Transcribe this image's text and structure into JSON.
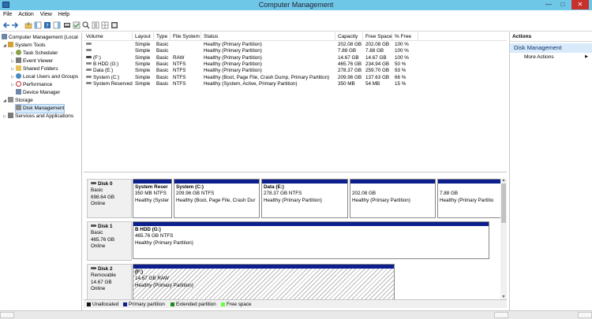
{
  "window": {
    "title": "Computer Management",
    "min": "—",
    "max": "□",
    "close": "✕"
  },
  "menu": [
    "File",
    "Action",
    "View",
    "Help"
  ],
  "tree": {
    "root": "Computer Management (Local",
    "system_tools": "System Tools",
    "task_scheduler": "Task Scheduler",
    "event_viewer": "Event Viewer",
    "shared_folders": "Shared Folders",
    "local_users": "Local Users and Groups",
    "performance": "Performance",
    "device_manager": "Device Manager",
    "storage": "Storage",
    "disk_management": "Disk Management",
    "services": "Services and Applications"
  },
  "volume_table": {
    "headers": [
      "Volume",
      "Layout",
      "Type",
      "File System",
      "Status",
      "Capacity",
      "Free Space",
      "% Free"
    ],
    "rows": [
      [
        "",
        "Simple",
        "Basic",
        "",
        "Healthy (Primary Partition)",
        "202.08 GB",
        "202.08 GB",
        "100 %"
      ],
      [
        "",
        "Simple",
        "Basic",
        "",
        "Healthy (Primary Partition)",
        "7.88 GB",
        "7.88 GB",
        "100 %"
      ],
      [
        "(F:)",
        "Simple",
        "Basic",
        "RAW",
        "Healthy (Primary Partition)",
        "14.67 GB",
        "14.67 GB",
        "100 %"
      ],
      [
        "B HDD (G:)",
        "Simple",
        "Basic",
        "NTFS",
        "Healthy (Primary Partition)",
        "465.76 GB",
        "234.94 GB",
        "50 %"
      ],
      [
        "Data (E:)",
        "Simple",
        "Basic",
        "NTFS",
        "Healthy (Primary Partition)",
        "278.37 GB",
        "259.70 GB",
        "93 %"
      ],
      [
        "System (C:)",
        "Simple",
        "Basic",
        "NTFS",
        "Healthy (Boot, Page File, Crash Dump, Primary Partition)",
        "209.96 GB",
        "137.63 GB",
        "66 %"
      ],
      [
        "System Reserved",
        "Simple",
        "Basic",
        "NTFS",
        "Healthy (System, Active, Primary Partition)",
        "350 MB",
        "54 MB",
        "15 %"
      ]
    ]
  },
  "disks": {
    "d0": {
      "name": "Disk 0",
      "type": "Basic",
      "size": "698.64 GB",
      "status": "Online",
      "parts": [
        {
          "name": "System Reser",
          "size": "350 MB NTFS",
          "status": "Healthy (Syster"
        },
        {
          "name": "System  (C:)",
          "size": "209.96 GB NTFS",
          "status": "Healthy (Boot, Page File, Crash Dur"
        },
        {
          "name": "Data  (E:)",
          "size": "278.37 GB NTFS",
          "status": "Healthy (Primary Partition)"
        },
        {
          "name": "",
          "size": "202.08 GB",
          "status": "Healthy (Primary Partition)"
        },
        {
          "name": "",
          "size": "7.88 GB",
          "status": "Healthy (Primary Partitio"
        }
      ]
    },
    "d1": {
      "name": "Disk 1",
      "type": "Basic",
      "size": "465.76 GB",
      "status": "Online",
      "parts": [
        {
          "name": "B HDD  (G:)",
          "size": "465.76 GB NTFS",
          "status": "Healthy (Primary Partition)"
        }
      ]
    },
    "d2": {
      "name": "Disk 2",
      "type": "Removable",
      "size": "14.67 GB",
      "status": "Online",
      "parts": [
        {
          "name": "(F:)",
          "size": "14.67 GB RAW",
          "status": "Healthy (Primary Partition)"
        }
      ]
    }
  },
  "legend": {
    "items": [
      "Unallocated",
      "Primary partition",
      "Extended partition",
      "Free space"
    ],
    "colors": [
      "#111111",
      "#0d1f8c",
      "#1e8b1e",
      "#66ff44"
    ]
  },
  "actions": {
    "header": "Actions",
    "section": "Disk Management",
    "more": "More Actions",
    "more_arrow": "▶"
  },
  "colors": {
    "titlebar": "#6fc7e7",
    "primary": "#0d1f8c",
    "close": "#c7302b"
  }
}
